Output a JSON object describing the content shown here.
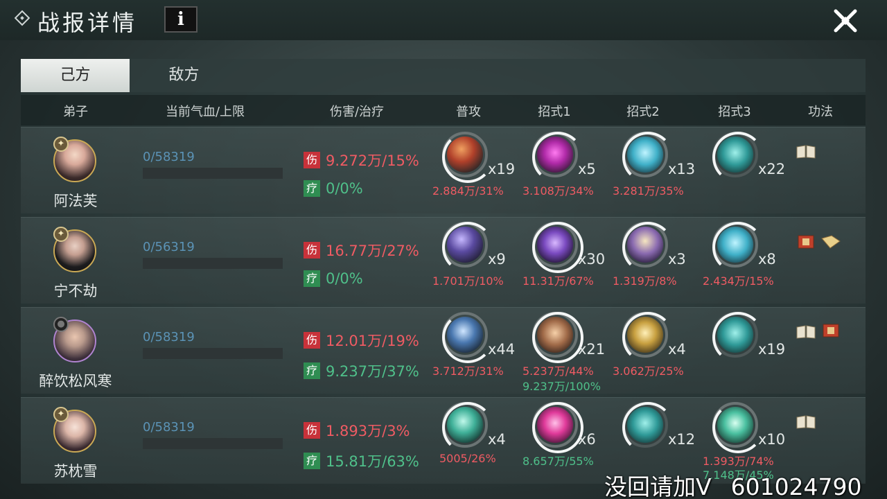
{
  "title": "战报详情",
  "info_label": "i",
  "tabs": [
    "己方",
    "敌方"
  ],
  "columns": {
    "disciple": "弟子",
    "hp": "当前气血/上限",
    "dmg_heal": "伤害/治疗",
    "normal": "普攻",
    "skill1": "招式1",
    "skill2": "招式2",
    "skill3": "招式3",
    "kungfu": "功法"
  },
  "tag_dmg": "伤",
  "tag_heal": "疗",
  "rows": [
    {
      "name": "阿法芙",
      "hp": "0/58319",
      "dmg": "9.272万/15%",
      "heal": "0/0%",
      "skills": [
        {
          "mult": "x19",
          "stat": "2.884万/31%",
          "stat2": ""
        },
        {
          "mult": "x5",
          "stat": "3.108万/34%",
          "stat2": ""
        },
        {
          "mult": "x13",
          "stat": "3.281万/35%",
          "stat2": ""
        },
        {
          "mult": "x22",
          "stat": "",
          "stat2": ""
        }
      ]
    },
    {
      "name": "宁不劫",
      "hp": "0/56319",
      "dmg": "16.77万/27%",
      "heal": "0/0%",
      "skills": [
        {
          "mult": "x9",
          "stat": "1.701万/10%",
          "stat2": ""
        },
        {
          "mult": "x30",
          "stat": "11.31万/67%",
          "stat2": ""
        },
        {
          "mult": "x3",
          "stat": "1.319万/8%",
          "stat2": ""
        },
        {
          "mult": "x8",
          "stat": "2.434万/15%",
          "stat2": ""
        }
      ]
    },
    {
      "name": "醉饮松风寒",
      "hp": "0/58319",
      "dmg": "12.01万/19%",
      "heal": "9.237万/37%",
      "skills": [
        {
          "mult": "x44",
          "stat": "3.712万/31%",
          "stat2": ""
        },
        {
          "mult": "x21",
          "stat": "5.237万/44%",
          "stat2": "9.237万/100%"
        },
        {
          "mult": "x4",
          "stat": "3.062万/25%",
          "stat2": ""
        },
        {
          "mult": "x19",
          "stat": "",
          "stat2": ""
        }
      ]
    },
    {
      "name": "苏枕雪",
      "hp": "0/58319",
      "dmg": "1.893万/3%",
      "heal": "15.81万/63%",
      "skills": [
        {
          "mult": "x4",
          "stat": "5005/26%",
          "stat2": ""
        },
        {
          "mult": "x6",
          "stat": "8.657万/55%",
          "stat2": ""
        },
        {
          "mult": "x12",
          "stat": "",
          "stat2": ""
        },
        {
          "mult": "x10",
          "stat": "1.393万/74%",
          "stat2": "7.148万/45%"
        }
      ]
    }
  ],
  "watermark": {
    "text": "没回请加V",
    "number": "601024790"
  },
  "colors": {
    "damage": "#ef5b63",
    "heal": "#4fc08a",
    "hp": "#5b93b6"
  }
}
